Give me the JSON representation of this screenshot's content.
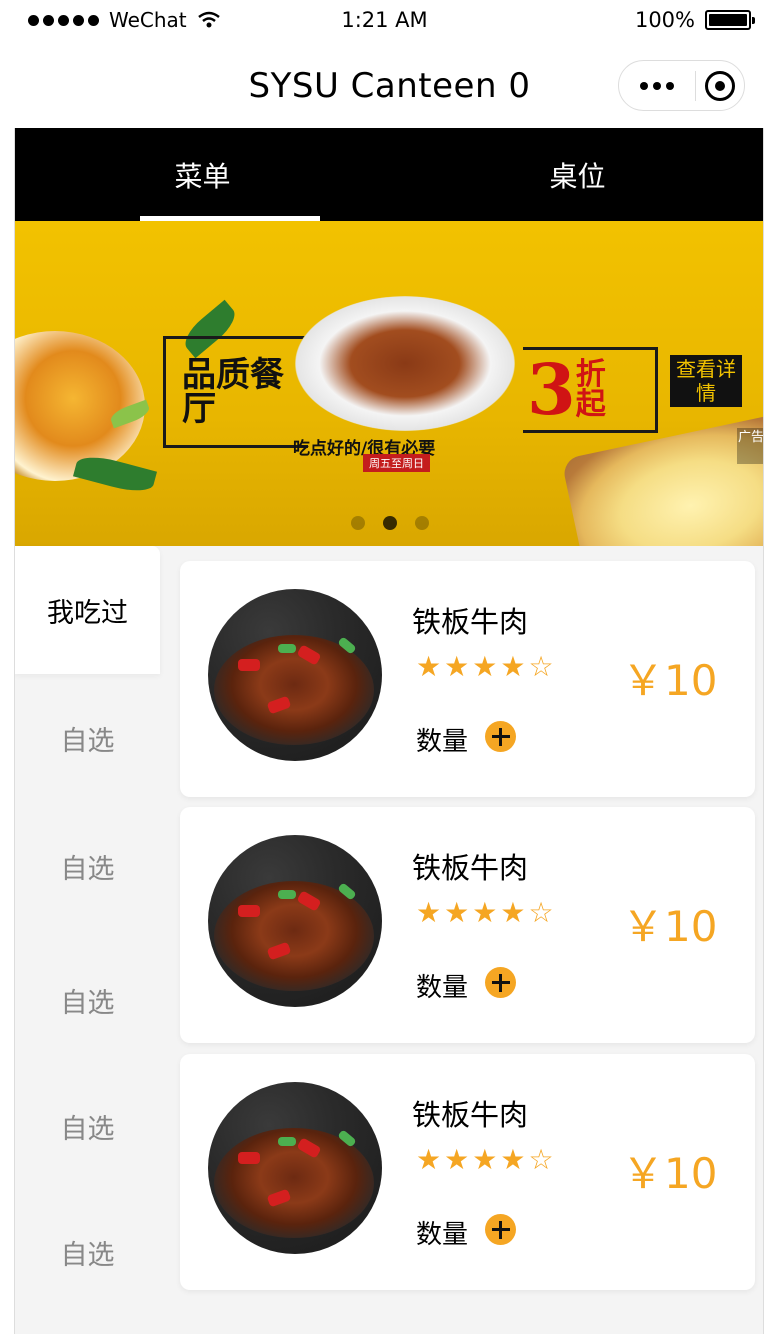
{
  "status_bar": {
    "carrier": "WeChat",
    "time": "1:21 AM",
    "battery": "100%",
    "battery_level": 1.0
  },
  "nav": {
    "title": "SYSU Canteen 0"
  },
  "tabs": [
    {
      "label": "菜单",
      "active": true
    },
    {
      "label": "桌位",
      "active": false
    }
  ],
  "banner": {
    "brand": "品质餐厅",
    "slogan": "吃点好的/很有必要",
    "days": "周五至周日",
    "discount_number": "3",
    "discount_text": "折起",
    "detail": "查看详情",
    "ad_label": "广告",
    "slide_count": 3,
    "active_slide": 1
  },
  "sidebar": {
    "items": [
      {
        "label": "我吃过",
        "active": true
      },
      {
        "label": "自选",
        "active": false
      },
      {
        "label": "自选",
        "active": false
      },
      {
        "label": "自选",
        "active": false
      },
      {
        "label": "自选",
        "active": false
      }
    ]
  },
  "dishes": [
    {
      "name": "铁板牛肉",
      "rating": 4,
      "max_rating": 5,
      "price": "￥10",
      "qty_label": "数量"
    },
    {
      "name": "铁板牛肉",
      "rating": 4,
      "max_rating": 5,
      "price": "￥10",
      "qty_label": "数量"
    },
    {
      "name": "铁板牛肉",
      "rating": 4,
      "max_rating": 5,
      "price": "￥10",
      "qty_label": "数量"
    }
  ],
  "colors": {
    "accent": "#f5a623",
    "tab_bar": "#000000",
    "background": "#f4f4f4"
  }
}
